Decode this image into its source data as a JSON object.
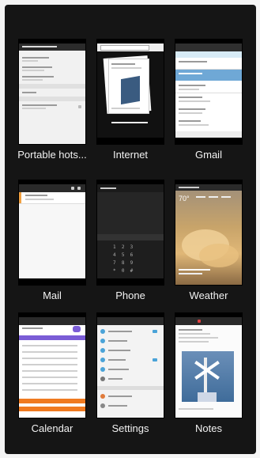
{
  "apps": [
    {
      "id": "portable-hotspot",
      "label": "Portable hots..."
    },
    {
      "id": "internet",
      "label": "Internet"
    },
    {
      "id": "gmail",
      "label": "Gmail"
    },
    {
      "id": "mail",
      "label": "Mail"
    },
    {
      "id": "phone",
      "label": "Phone"
    },
    {
      "id": "weather",
      "label": "Weather"
    },
    {
      "id": "calendar",
      "label": "Calendar"
    },
    {
      "id": "settings",
      "label": "Settings"
    },
    {
      "id": "notes",
      "label": "Notes"
    }
  ],
  "colors": {
    "screen_bg": "#151515",
    "label_text": "#f2f2f2",
    "gmail_accent": "#6fa8d6",
    "mail_accent": "#f0a040",
    "calendar_accent": "#7a5cd6",
    "calendar_event": "#f07a20",
    "weather_sky": "#c8a46a"
  },
  "icons": [
    "settings-thumbnail",
    "browser-thumbnail",
    "email-thumbnail",
    "dialpad-thumbnail",
    "clouds-thumbnail",
    "calendar-thumbnail",
    "notes-thumbnail"
  ]
}
